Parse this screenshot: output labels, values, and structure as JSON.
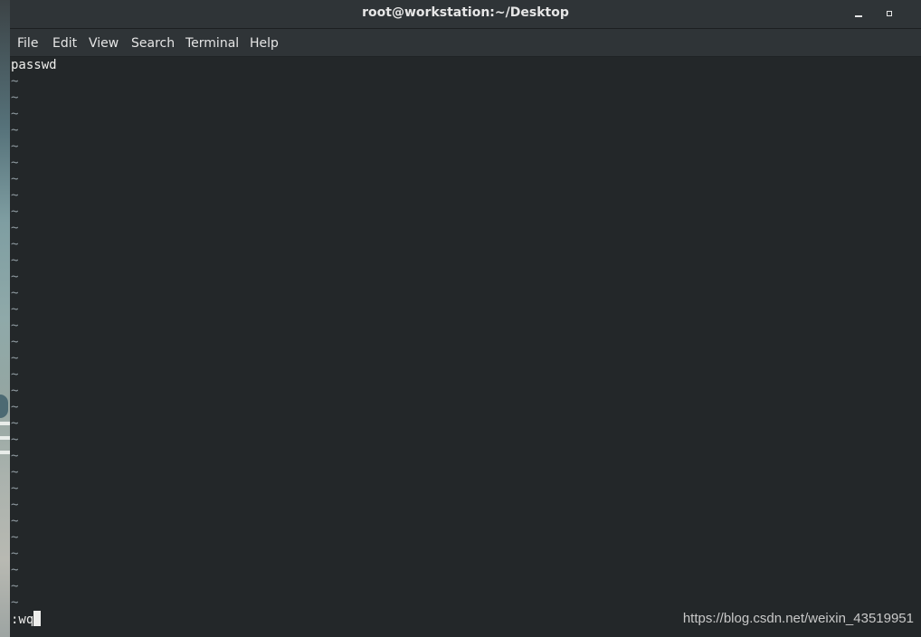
{
  "window": {
    "title": "root@workstation:~/Desktop"
  },
  "menu": [
    "File",
    "Edit",
    "View",
    "Search",
    "Terminal",
    "Help"
  ],
  "editor": {
    "first_line": "passwd",
    "empty_line_marker": "~",
    "empty_line_count": 33,
    "command_line": ":wq"
  },
  "watermark": "https://blog.csdn.net/weixin_43519951",
  "colors": {
    "background": "#232729",
    "titlebar": "#2f3437",
    "text": "#eeeeec",
    "tilde": "#8f9aa0"
  }
}
